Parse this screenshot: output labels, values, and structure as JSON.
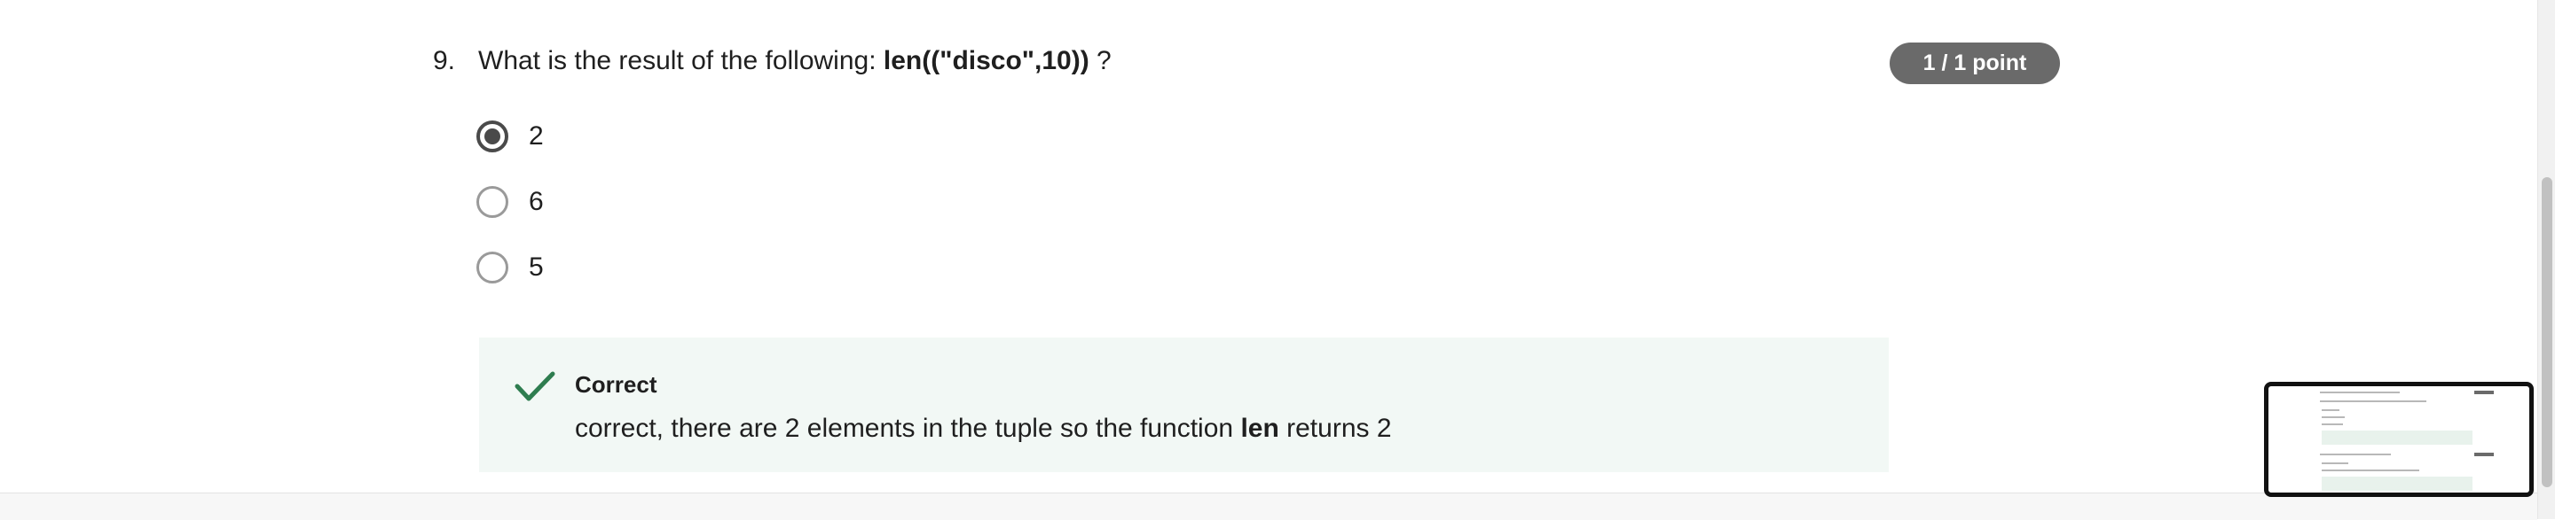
{
  "question": {
    "number": "9.",
    "text_before": "What is the result of the following: ",
    "code": "len((\"disco\",10))",
    "text_after": " ?",
    "points": "1 / 1 point"
  },
  "options": [
    {
      "label": "2",
      "selected": true
    },
    {
      "label": "6",
      "selected": false
    },
    {
      "label": "5",
      "selected": false
    }
  ],
  "feedback": {
    "title": "Correct",
    "text_before": "correct, there are 2 elements in the tuple so the function ",
    "keyword": "len",
    "text_after": " returns 2",
    "icon": "checkmark-icon",
    "color": "#2e7d4f"
  },
  "colors": {
    "badge_bg": "#6a6a6a",
    "feedback_bg": "#f2f8f5",
    "radio_selected": "#4a4a4a"
  }
}
